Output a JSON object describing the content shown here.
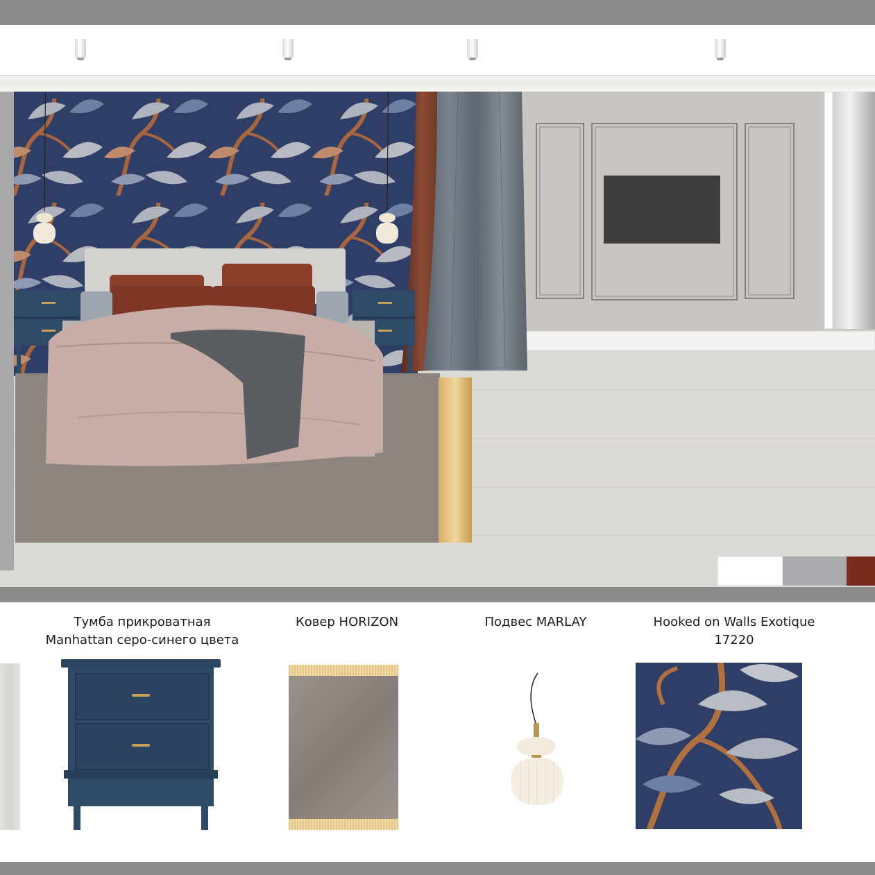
{
  "colors": {
    "band": "#8c8c8e",
    "wallpaper_navy": "#2f3e66",
    "wall_gray": "#c9c5c1",
    "floor": "#dcdad6",
    "tv": "#3d3d3d",
    "curtain_rust": "#6e3a2a",
    "curtain_gray": "#6b747c",
    "rug": "#8f8580",
    "nightstand": "#2f4a66"
  },
  "palette_swatches": [
    "#ffffff",
    "#a9aaad",
    "#7a2d1c"
  ],
  "icons": [
    "ceiling-spotlight-icon",
    "pendant-lamp-icon",
    "wallpaper-tree-icon"
  ],
  "products": [
    {
      "caption": "Тумба прикроватная\nManhattan серо-синего цвета"
    },
    {
      "caption": "Ковер HORIZON"
    },
    {
      "caption": "Подвес MARLAY"
    },
    {
      "caption": "Hooked on Walls Exotique\n17220"
    }
  ]
}
